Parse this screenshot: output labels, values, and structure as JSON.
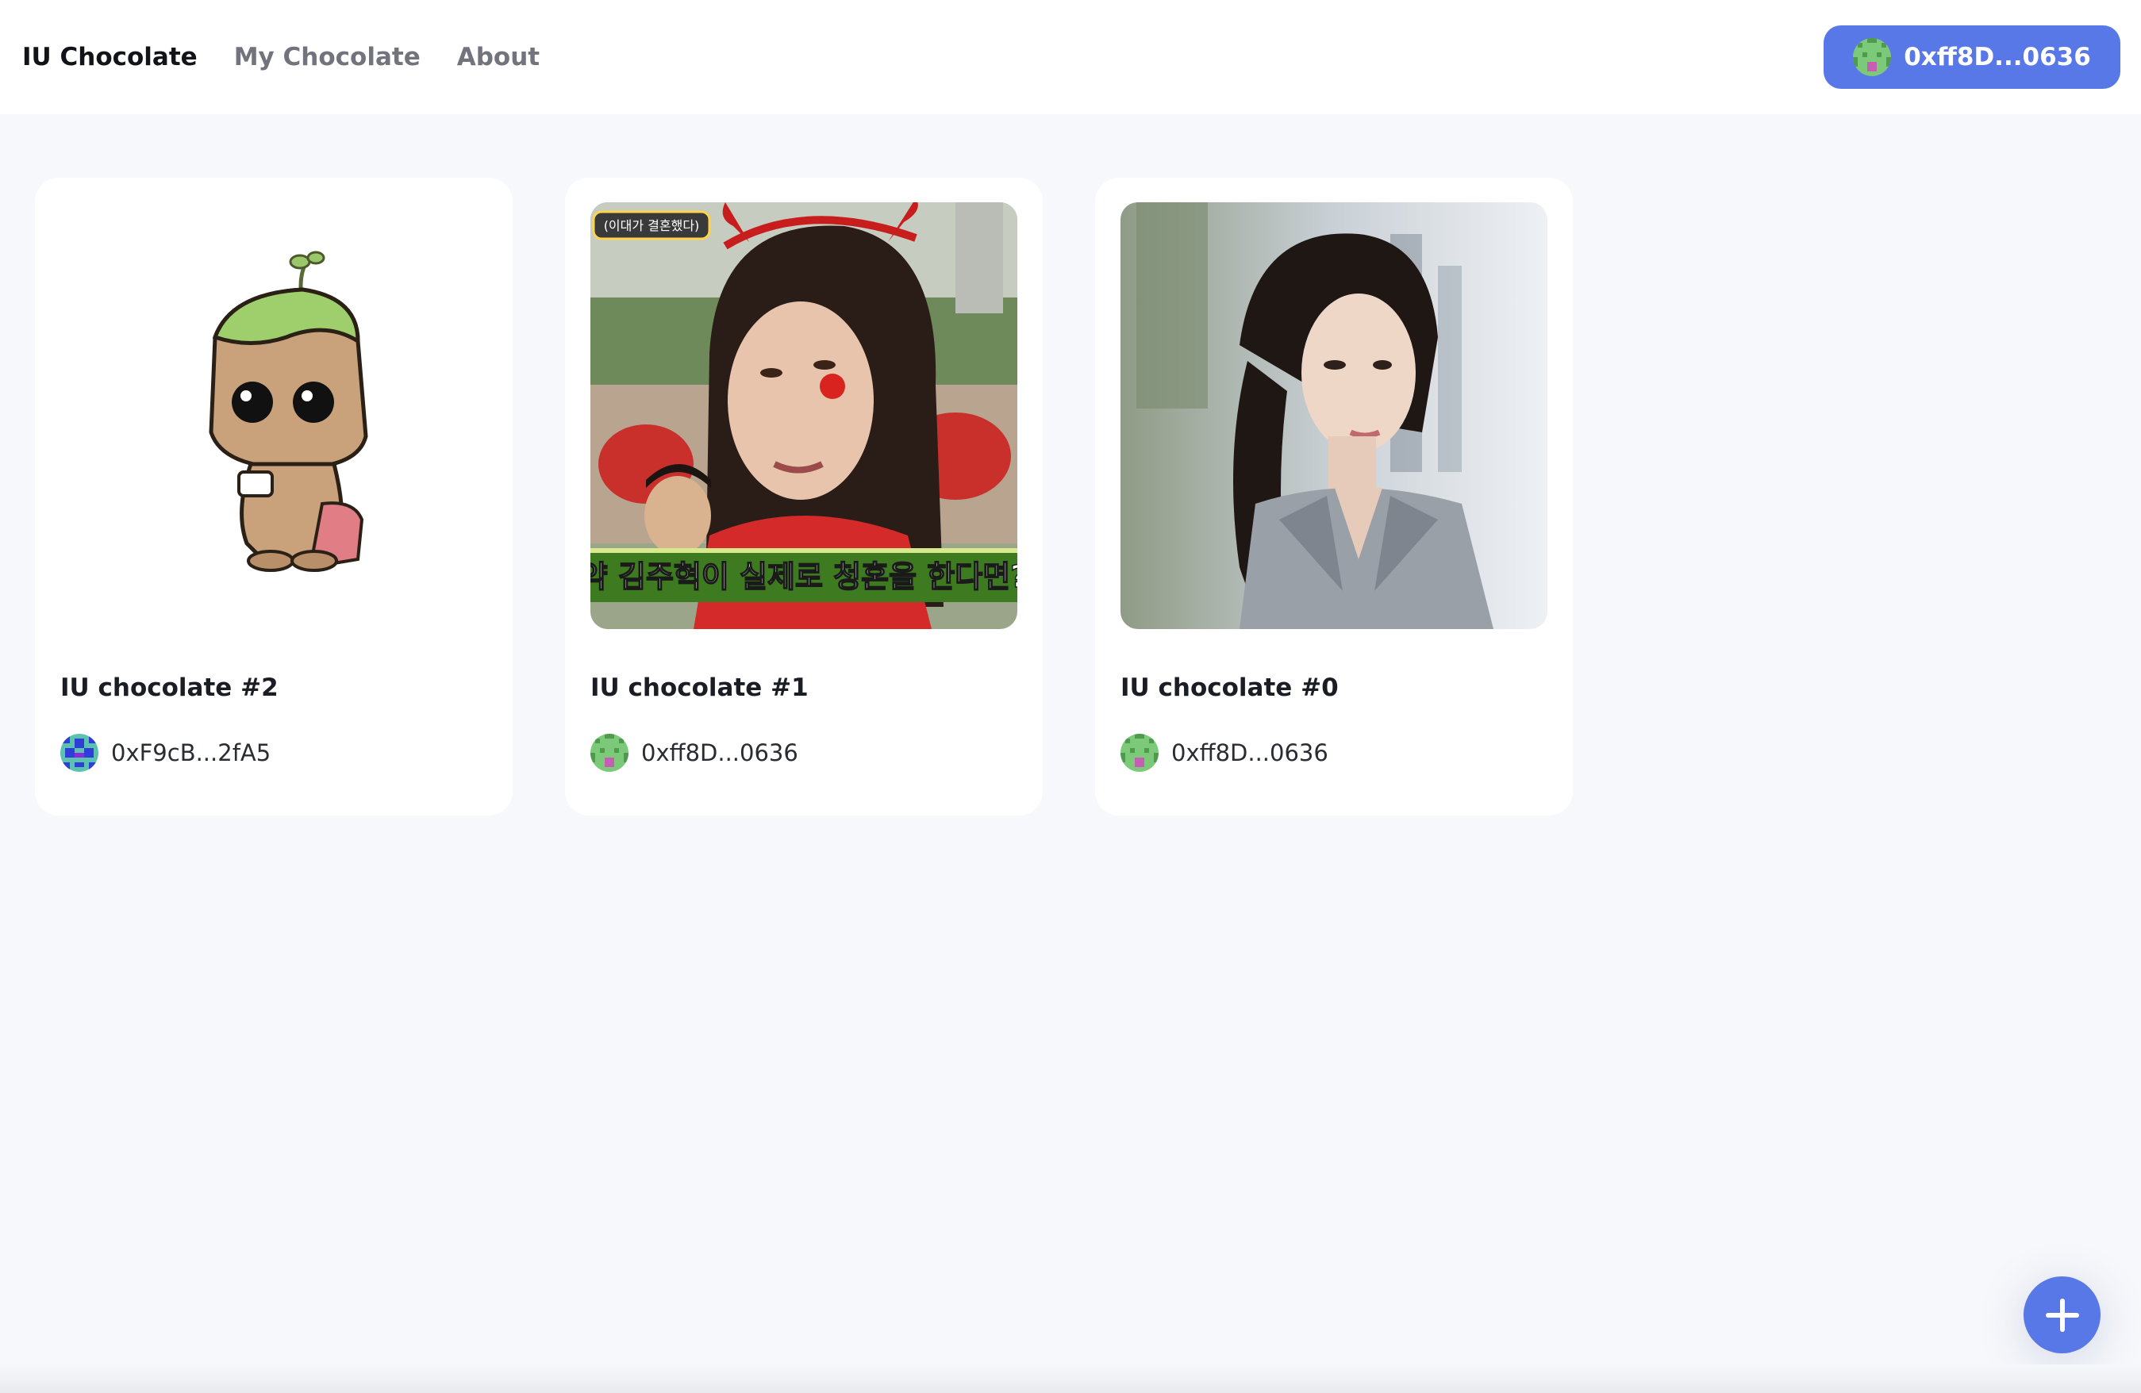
{
  "nav": {
    "brand": "IU Chocolate",
    "links": [
      "My Chocolate",
      "About"
    ]
  },
  "wallet": {
    "address": "0xff8D...0636",
    "avatar_icon": "green-identicon"
  },
  "cards": [
    {
      "title": "IU chocolate #2",
      "owner": "0xF9cB...2fA5",
      "owner_avatar": "blue-identicon",
      "image": "baby-groot-cartoon"
    },
    {
      "title": "IU chocolate #1",
      "owner": "0xff8D...0636",
      "owner_avatar": "green-identicon",
      "image": "woman-with-devil-horns-tv-screenshot",
      "caption": "약 김주혁이 실제로 청혼을 한다면?",
      "badge": "(이대가 결혼했다)"
    },
    {
      "title": "IU chocolate #0",
      "owner": "0xff8D...0636",
      "owner_avatar": "green-identicon",
      "image": "woman-in-grey-blazer-portrait"
    }
  ],
  "fab": {
    "icon": "plus-icon"
  },
  "colors": {
    "accent": "#5878e8",
    "background": "#f7f8fb",
    "card": "#ffffff"
  }
}
